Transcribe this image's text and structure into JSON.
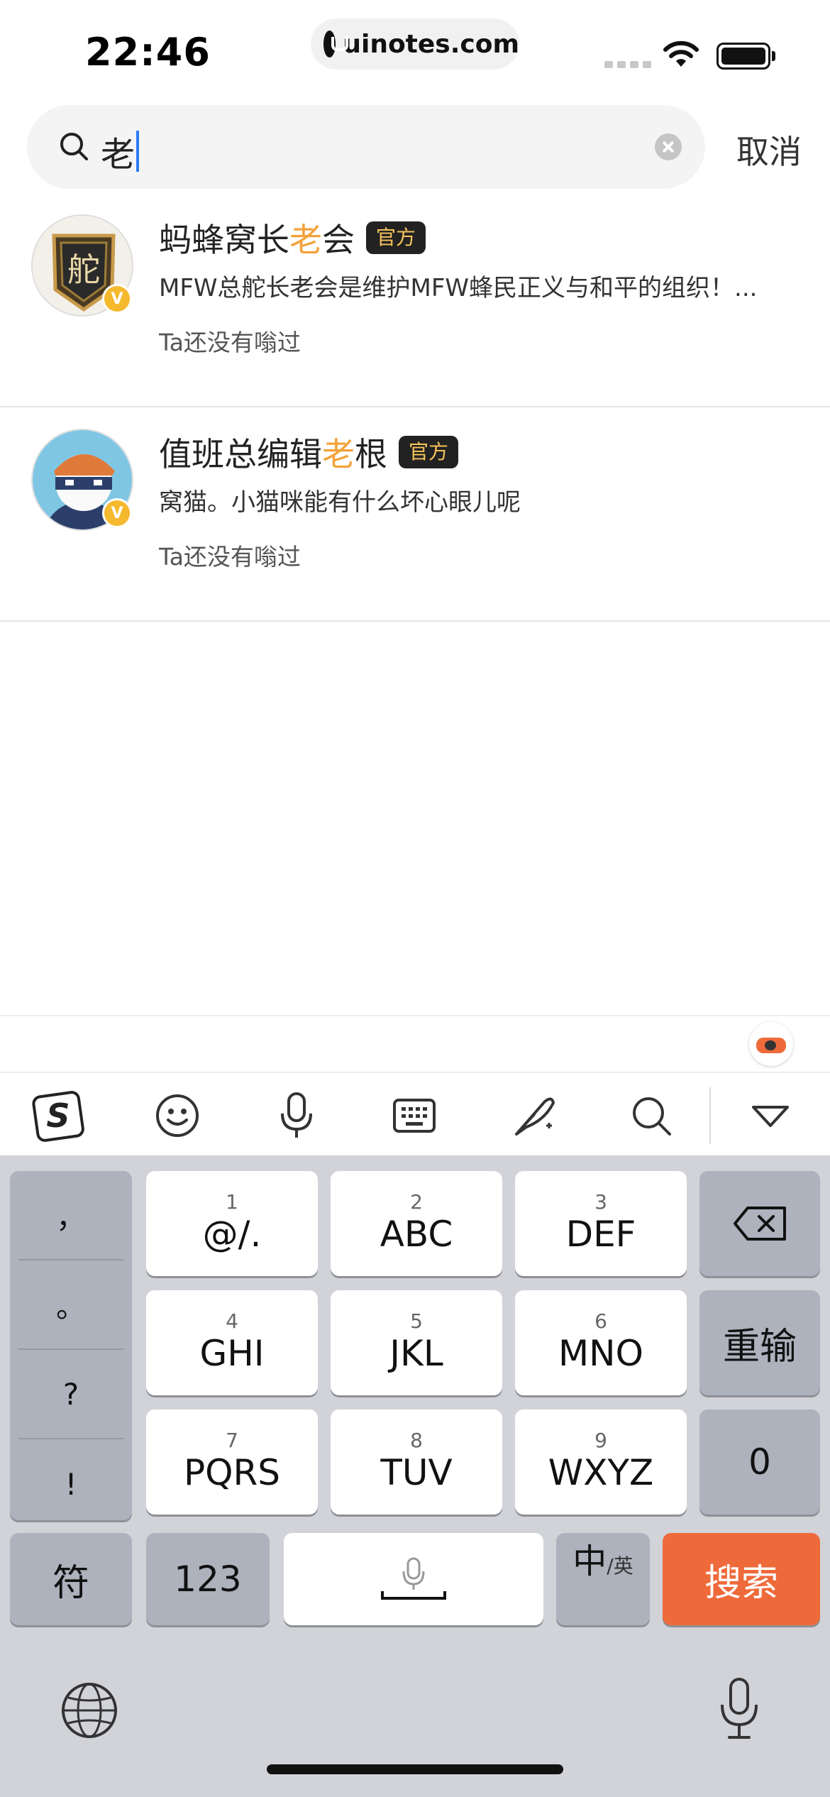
{
  "status_bar": {
    "time": "22:46",
    "url": "uinotes.com"
  },
  "search": {
    "query": "老",
    "cancel_label": "取消"
  },
  "results": [
    {
      "title_before": "蚂蜂窝长",
      "title_highlight": "老",
      "title_after": "会",
      "tag": "官方",
      "description": "MFW总舵长老会是维护MFW蜂民正义与和平的组织！...",
      "meta": "Ta还没有嗡过",
      "avatar_glyph": "舵"
    },
    {
      "title_before": "值班总编辑",
      "title_highlight": "老",
      "title_after": "根",
      "tag": "官方",
      "description": "窝猫。小猫咪能有什么坏心眼儿呢",
      "meta": "Ta还没有嗡过"
    }
  ],
  "keyboard": {
    "punctuation": [
      "，",
      "。",
      "?",
      "!"
    ],
    "rows": [
      [
        {
          "num": "1",
          "letters": "@/."
        },
        {
          "num": "2",
          "letters": "ABC"
        },
        {
          "num": "3",
          "letters": "DEF"
        }
      ],
      [
        {
          "num": "4",
          "letters": "GHI"
        },
        {
          "num": "5",
          "letters": "JKL"
        },
        {
          "num": "6",
          "letters": "MNO"
        }
      ],
      [
        {
          "num": "7",
          "letters": "PQRS"
        },
        {
          "num": "8",
          "letters": "TUV"
        },
        {
          "num": "9",
          "letters": "WXYZ"
        }
      ]
    ],
    "reinput_label": "重输",
    "zero_label": "0",
    "symbol_label": "符",
    "numeric_label": "123",
    "lang_main": "中",
    "lang_sub": "/英",
    "search_label": "搜索"
  },
  "colors": {
    "highlight": "#f3a23a",
    "search_key": "#ef6a3a",
    "caret": "#2d7cf6"
  }
}
